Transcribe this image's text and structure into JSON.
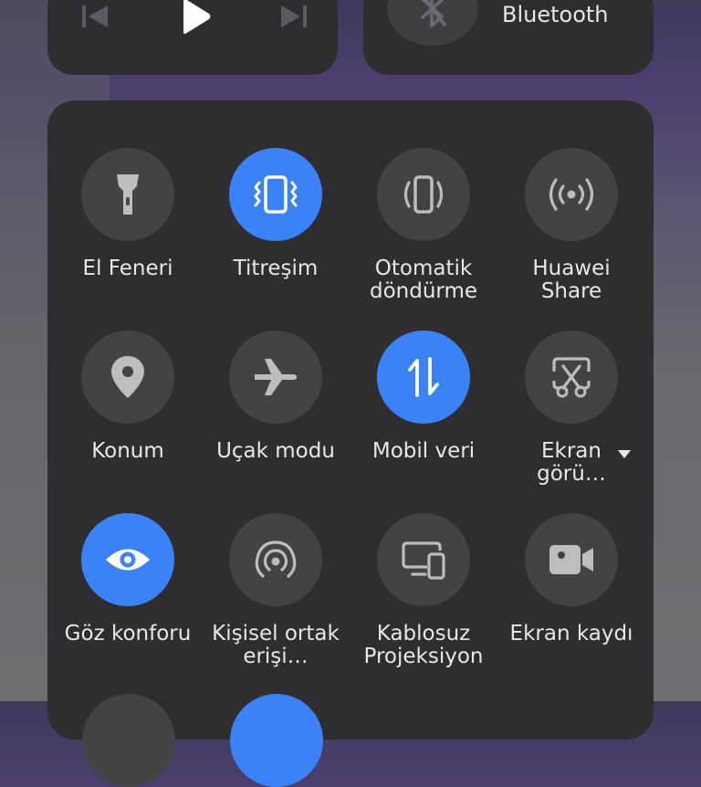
{
  "media": {
    "prev_icon": "skip-previous-icon",
    "play_icon": "play-icon",
    "next_icon": "skip-next-icon"
  },
  "bluetooth": {
    "label": "Bluetooth",
    "icon": "bluetooth-icon"
  },
  "tiles": [
    {
      "id": "flashlight",
      "label": "El Feneri",
      "icon": "flashlight-icon",
      "active": false
    },
    {
      "id": "vibration",
      "label": "Titreşim",
      "icon": "vibrate-icon",
      "active": true
    },
    {
      "id": "autorotate",
      "label": "Otomatik döndürme",
      "icon": "auto-rotate-icon",
      "active": false
    },
    {
      "id": "huawei-share",
      "label": "Huawei Share",
      "icon": "huawei-share-icon",
      "active": false
    },
    {
      "id": "location",
      "label": "Konum",
      "icon": "location-pin-icon",
      "active": false
    },
    {
      "id": "airplane",
      "label": "Uçak modu",
      "icon": "airplane-icon",
      "active": false
    },
    {
      "id": "mobile-data",
      "label": "Mobil veri",
      "icon": "mobile-data-icon",
      "active": true
    },
    {
      "id": "screenshot",
      "label": "Ekran görü…",
      "icon": "screenshot-icon",
      "active": false,
      "has_dropdown": true
    },
    {
      "id": "eye-comfort",
      "label": "Göz konforu",
      "icon": "eye-icon",
      "active": true
    },
    {
      "id": "hotspot",
      "label": "Kişisel ortak erişi…",
      "icon": "hotspot-icon",
      "active": false
    },
    {
      "id": "projection",
      "label": "Kablosuz Projeksiyon",
      "icon": "wireless-projection-icon",
      "active": false
    },
    {
      "id": "screen-record",
      "label": "Ekran kaydı",
      "icon": "screen-record-icon",
      "active": false
    }
  ],
  "colors": {
    "panel": "#2e2e30",
    "tile_off": "#434346",
    "tile_on": "#3b82f6",
    "text": "#e7e7e7"
  }
}
